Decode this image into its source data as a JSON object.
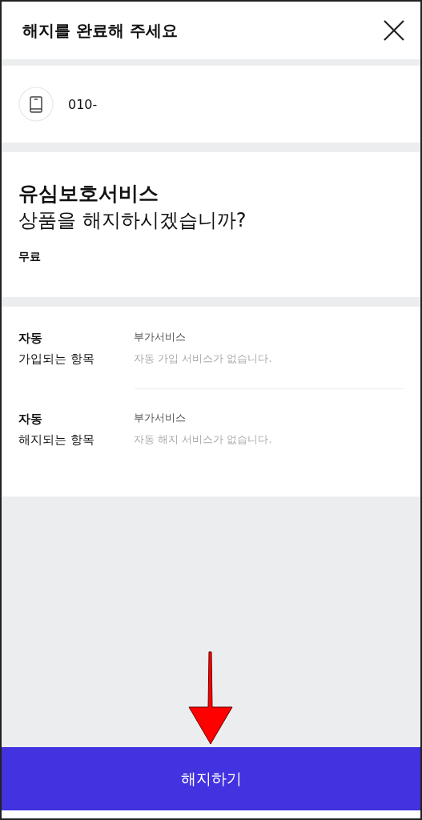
{
  "header": {
    "title": "해지를 완료해 주세요"
  },
  "line": {
    "number": "010-"
  },
  "product": {
    "name": "유심보호서비스",
    "question": "상품을 해지하시겠습니까?",
    "price": "무료"
  },
  "auto_items": [
    {
      "label_bold": "자동",
      "label": "가입되는 항목",
      "category": "부가서비스",
      "message": "자동 가입 서비스가 없습니다."
    },
    {
      "label_bold": "자동",
      "label": "해지되는 항목",
      "category": "부가서비스",
      "message": "자동 해지 서비스가 없습니다."
    }
  ],
  "button": {
    "label": "해지하기"
  }
}
